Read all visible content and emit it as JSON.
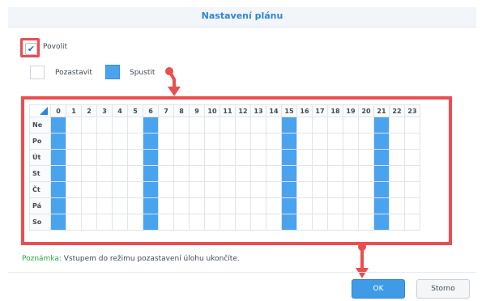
{
  "dialog": {
    "title": "Nastavení plánu"
  },
  "enable": {
    "label": "Povolit",
    "checked": true,
    "check_glyph": "✔"
  },
  "legend": {
    "pause_label": "Pozastavit",
    "run_label": "Spustit"
  },
  "schedule": {
    "hours": [
      "0",
      "1",
      "2",
      "3",
      "4",
      "5",
      "6",
      "7",
      "8",
      "9",
      "10",
      "11",
      "12",
      "13",
      "14",
      "15",
      "16",
      "17",
      "18",
      "19",
      "20",
      "21",
      "22",
      "23"
    ],
    "days": [
      "Ne",
      "Po",
      "Út",
      "St",
      "Čt",
      "Pá",
      "So"
    ],
    "run_hours": [
      0,
      6,
      15,
      21
    ]
  },
  "note": {
    "key": "Poznámka:",
    "text": " Vstupem do režimu pozastavení úlohu ukončíte."
  },
  "buttons": {
    "ok": "OK",
    "cancel": "Storno"
  },
  "colors": {
    "accent": "#3f9be6",
    "highlight": "#ea4e4e",
    "run_cell": "#4aa3ee",
    "note_key": "#2ea043"
  }
}
